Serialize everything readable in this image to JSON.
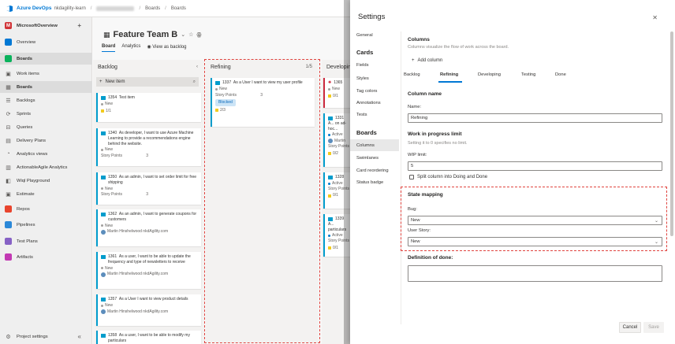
{
  "topbar": {
    "brand": "Azure DevOps",
    "org": "nkdagility-learn",
    "crumbs": [
      "Boards",
      "Boards"
    ]
  },
  "leftnav": {
    "project": "MicrosoftOverview",
    "project_initial": "M",
    "items": [
      {
        "label": "Overview",
        "icon": "overview-icon",
        "color": "#0078d4"
      },
      {
        "label": "Boards",
        "icon": "boards-icon",
        "color": "#0ab25c"
      },
      {
        "label": "Work items",
        "icon": "work-items-icon"
      },
      {
        "label": "Boards",
        "icon": "board-icon"
      },
      {
        "label": "Backlogs",
        "icon": "backlogs-icon"
      },
      {
        "label": "Sprints",
        "icon": "sprints-icon"
      },
      {
        "label": "Queries",
        "icon": "queries-icon"
      },
      {
        "label": "Delivery Plans",
        "icon": "delivery-plans-icon"
      },
      {
        "label": "Analytics views",
        "icon": "analytics-icon"
      },
      {
        "label": "ActionableAgile Analytics",
        "icon": "extension-icon"
      },
      {
        "label": "Wiql Playground",
        "icon": "wiql-icon"
      },
      {
        "label": "Estimate",
        "icon": "estimate-icon"
      },
      {
        "label": "Repos",
        "icon": "repos-icon",
        "color": "#e8442d"
      },
      {
        "label": "Pipelines",
        "icon": "pipelines-icon",
        "color": "#2b88d8"
      },
      {
        "label": "Test Plans",
        "icon": "test-plans-icon",
        "color": "#8661c5"
      },
      {
        "label": "Artifacts",
        "icon": "artifacts-icon",
        "color": "#c239b3"
      }
    ],
    "settings": "Project settings"
  },
  "board": {
    "team": "Feature Team B",
    "tabs": [
      "Board",
      "Analytics"
    ],
    "view_backlog": "View as backlog",
    "columns": {
      "backlog": {
        "name": "Backlog",
        "new_item": "New item"
      },
      "refining": {
        "name": "Refining",
        "count": "1/5"
      },
      "developing": {
        "name": "Developing"
      }
    },
    "backlog_cards": [
      {
        "id": "1354",
        "title": "Test item",
        "state": "New",
        "tasks": "1/1"
      },
      {
        "id": "1340",
        "title": "As developer, I want to use Azure Machine Learning to provide a recommendations engine behind the website.",
        "state": "New",
        "sp_label": "Story Points",
        "sp": "3"
      },
      {
        "id": "1350",
        "title": "As an admin, I want to set order limit for free shipping",
        "state": "New",
        "sp_label": "Story Points",
        "sp": "3"
      },
      {
        "id": "1362",
        "title": "As an admin, I want to generate coupons for customers",
        "state": "New",
        "assignee": "Martin Hinshelwood nkdAgility.com"
      },
      {
        "id": "1361",
        "title": "As a user, I want to be able to update the frequency and type of newsletters to receive",
        "state": "New",
        "assignee": "Martin Hinshelwood nkdAgility.com"
      },
      {
        "id": "1357",
        "title": "As a User I want to view product details",
        "state": "New",
        "assignee": "Martin Hinshelwood nkdAgility.com"
      },
      {
        "id": "1358",
        "title": "As a user, I want to be able to modify my particulars",
        "state": ""
      }
    ],
    "refining_card": {
      "id": "1337",
      "title": "As a User I want to view my user profile",
      "state": "New",
      "sp_label": "Story Points",
      "sp": "3",
      "tag": "Blocked",
      "tasks": "2/3"
    },
    "developing_cards": [
      {
        "id": "1365",
        "title": "",
        "state": "New",
        "tasks": "0/1"
      },
      {
        "id": "1331",
        "title": "A... on ad-hoc...",
        "state": "Active",
        "assignee": "Martin",
        "sp_label": "Story Points",
        "tasks": "0/2"
      },
      {
        "id": "1328",
        "title": "A...",
        "state": "Active",
        "sp_label": "Story Points",
        "tasks": "0/1"
      },
      {
        "id": "1339",
        "title": "A... particulars",
        "state": "Active",
        "sp_label": "Story Points",
        "tasks": "0/1"
      }
    ]
  },
  "settings": {
    "title": "Settings",
    "nav": [
      {
        "label": "General"
      },
      {
        "label": "Cards",
        "header": true
      },
      {
        "label": "Fields"
      },
      {
        "label": "Styles"
      },
      {
        "label": "Tag colors"
      },
      {
        "label": "Annotations"
      },
      {
        "label": "Tests"
      },
      {
        "label": "Boards",
        "header": true
      },
      {
        "label": "Columns",
        "selected": true
      },
      {
        "label": "Swimlanes"
      },
      {
        "label": "Card reordering"
      },
      {
        "label": "Status badge"
      }
    ],
    "columns_title": "Columns",
    "columns_sub": "Columns visualize the flow of work across the board.",
    "add_column": "Add column",
    "column_tabs": [
      "Backlog",
      "Refining",
      "Developing",
      "Testing",
      "Done"
    ],
    "column_name_title": "Column name",
    "name_label": "Name:",
    "name_value": "Refining",
    "wip_title": "Work in progress limit",
    "wip_sub": "Setting it to 0 specifies no limit.",
    "wip_label": "WIP limit:",
    "wip_value": "5",
    "split_label": "Split column into Doing and Done",
    "state_title": "State mapping",
    "bug_label": "Bug:",
    "bug_value": "New",
    "story_label": "User Story:",
    "story_value": "New",
    "dod_label": "Definition of done:",
    "cancel": "Cancel",
    "save": "Save"
  }
}
